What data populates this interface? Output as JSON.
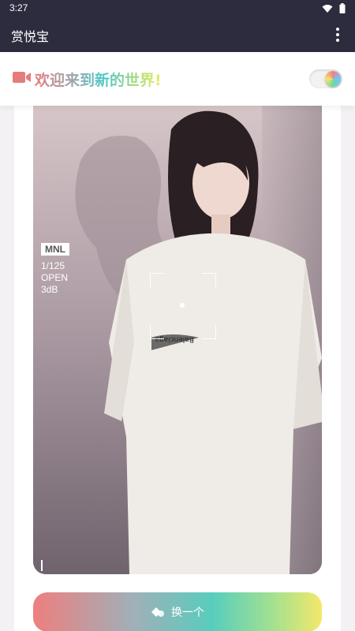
{
  "status_bar": {
    "time": "3:27",
    "icons": [
      "wifi-icon",
      "battery-icon"
    ]
  },
  "app_bar": {
    "title": "赏悦宝",
    "menu_icon": "more-vertical-icon"
  },
  "welcome": {
    "text": "欢迎来到新的世界!",
    "icon": "video-camera-icon",
    "toggle_on": true
  },
  "video": {
    "mode_tag": "MNL",
    "shutter": "1/125",
    "aperture": "OPEN",
    "gain": "3dB"
  },
  "action": {
    "label": "换一个",
    "icon": "switch-icon"
  },
  "colors": {
    "header": "#2c2c3e",
    "gradient_start": "#ee7f7f",
    "gradient_mid": "#58cdbd",
    "gradient_end": "#f3e86a"
  }
}
